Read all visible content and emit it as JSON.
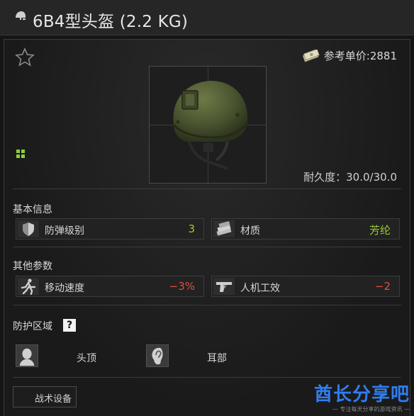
{
  "window": {
    "title": "6B4型头盔 (2.2 KG)",
    "title_icon": "helmet-icon"
  },
  "header": {
    "favorite_icon": "star-icon",
    "price_icon": "money-icon",
    "price_label": "参考单价:",
    "price_value": "2881"
  },
  "item": {
    "image": "helmet-image",
    "durability": "耐久度：30.0/30.0"
  },
  "basic_info": {
    "title": "基本信息",
    "stats": [
      {
        "icon": "shield-icon",
        "label": "防弹级别",
        "value": "3",
        "color": "#9acd32"
      },
      {
        "icon": "material-icon",
        "label": "材质",
        "value": "芳纶",
        "color": "#9acd32"
      }
    ]
  },
  "other_params": {
    "title": "其他参数",
    "stats": [
      {
        "icon": "running-icon",
        "label": "移动速度",
        "value": "−3%",
        "color": "#e0503a"
      },
      {
        "icon": "pistol-icon",
        "label": "人机工效",
        "value": "−2",
        "color": "#e0503a"
      }
    ]
  },
  "protection": {
    "title": "防护区域",
    "help_label": "?",
    "zones": [
      {
        "icon": "head-icon",
        "label": "头顶"
      },
      {
        "icon": "ear-icon",
        "label": "耳部"
      }
    ]
  },
  "tabs": [
    {
      "label": "战术设备"
    }
  ],
  "watermark": {
    "title": "酋长分享吧",
    "subtitle": "— 专注每天分享的游戏资讯 —"
  },
  "colors": {
    "accent_positive": "#9acd32",
    "accent_negative": "#e0503a",
    "watermark": "#2f7df0"
  }
}
